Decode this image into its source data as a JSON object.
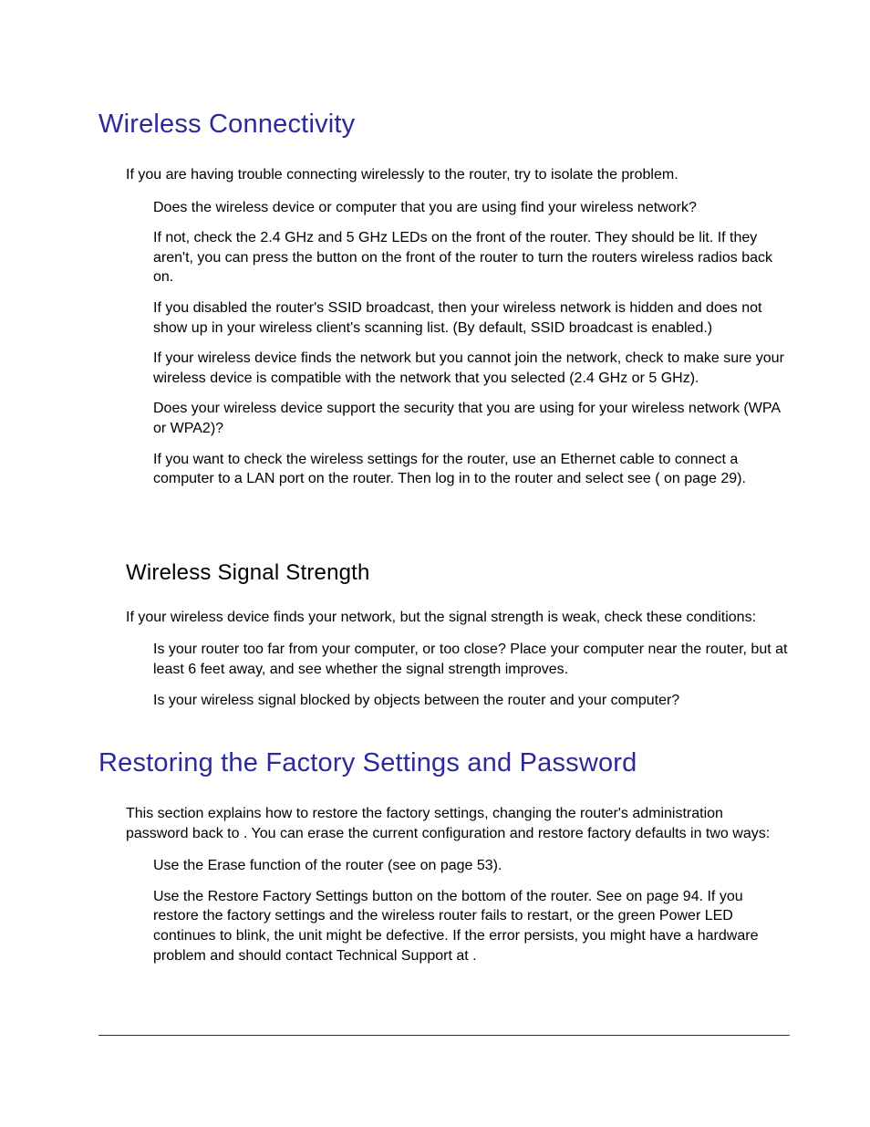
{
  "section1": {
    "title": "Wireless Connectivity",
    "intro": "If you are having trouble connecting wirelessly to the router, try to isolate the problem.",
    "b1": "Does the wireless device or computer that you are using find your wireless network?",
    "b2": "If not, check the 2.4 GHz and 5 GHz LEDs on the front of the router. They should be lit. If they aren't, you can press the                     button on the front of the router to turn the routers wireless radios back on.",
    "b3": "If you disabled the router's SSID broadcast, then your wireless network is hidden and does not show up in your wireless client's scanning list. (By default, SSID broadcast is enabled.)",
    "b4": "If your wireless device finds the network but you cannot join the network, check to make sure your wireless device is compatible with the network that you selected (2.4 GHz or 5 GHz).",
    "b5": "Does your wireless device support the security that you are using for your wireless network (WPA or WPA2)?",
    "b6": "If you want to check the wireless settings for the router, use an Ethernet cable to connect a computer to a LAN port on the router. Then log in to the router and select                                        see (                                                  on page 29)."
  },
  "section2": {
    "title": "Wireless Signal Strength",
    "intro": "If your wireless device finds your network, but the signal strength is weak, check these conditions:",
    "b1": "Is your router too far from your computer, or too close? Place your computer near the router, but at least 6 feet away, and see whether the signal strength improves.",
    "b2": "Is your wireless signal blocked by objects between the router and your computer?"
  },
  "section3": {
    "title": "Restoring the Factory Settings and Password",
    "intro": "This section explains how to restore the factory settings, changing the router's administration password back to                   . You can erase the current configuration and restore factory defaults in two ways:",
    "b1": "Use the Erase function of the router (see            on page 53).",
    "b2": "Use the Restore Factory Settings button on the bottom of the router. See                           on page 94. If you restore the factory settings and the wireless router fails to restart, or the green Power LED continues to blink, the unit might be defective. If the error persists, you might have a hardware problem and should contact Technical Support at                                                          ."
  }
}
